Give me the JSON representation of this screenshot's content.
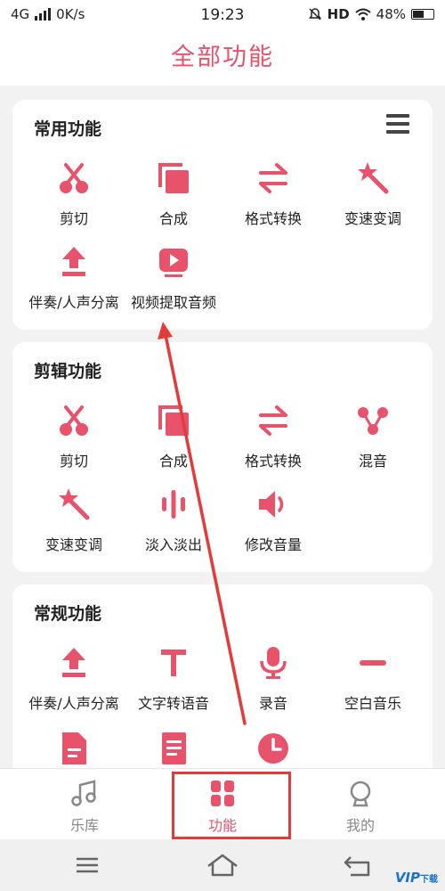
{
  "status": {
    "network": "4G",
    "speed": "0K/s",
    "time": "19:23",
    "hd": "HD",
    "battery": "48%"
  },
  "header": {
    "title": "全部功能"
  },
  "sections": [
    {
      "title": "常用功能",
      "items": [
        {
          "label": "剪切",
          "icon": "scissors-icon"
        },
        {
          "label": "合成",
          "icon": "merge-icon"
        },
        {
          "label": "格式转换",
          "icon": "convert-icon"
        },
        {
          "label": "变速变调",
          "icon": "magic-wand-icon"
        },
        {
          "label": "伴奏/人声分离",
          "icon": "upload-icon"
        },
        {
          "label": "视频提取音频",
          "icon": "video-icon"
        }
      ]
    },
    {
      "title": "剪辑功能",
      "items": [
        {
          "label": "剪切",
          "icon": "scissors-icon"
        },
        {
          "label": "合成",
          "icon": "merge-icon"
        },
        {
          "label": "格式转换",
          "icon": "convert-icon"
        },
        {
          "label": "混音",
          "icon": "mix-icon"
        },
        {
          "label": "变速变调",
          "icon": "magic-wand-icon"
        },
        {
          "label": "淡入淡出",
          "icon": "waveform-icon"
        },
        {
          "label": "修改音量",
          "icon": "volume-icon"
        }
      ]
    },
    {
      "title": "常规功能",
      "items": [
        {
          "label": "伴奏/人声分离",
          "icon": "upload-icon"
        },
        {
          "label": "文字转语音",
          "icon": "text-icon"
        },
        {
          "label": "录音",
          "icon": "microphone-icon"
        },
        {
          "label": "空白音乐",
          "icon": "minus-icon"
        }
      ]
    }
  ],
  "tabs": [
    {
      "label": "乐库",
      "icon": "music-note-icon",
      "active": false
    },
    {
      "label": "功能",
      "icon": "grid-icon",
      "active": true
    },
    {
      "label": "我的",
      "icon": "profile-icon",
      "active": false
    }
  ],
  "watermark": {
    "brand": "VIP",
    "suffix": "下载"
  },
  "colors": {
    "accent": "#e8526b",
    "annotation": "#e53a3a"
  }
}
